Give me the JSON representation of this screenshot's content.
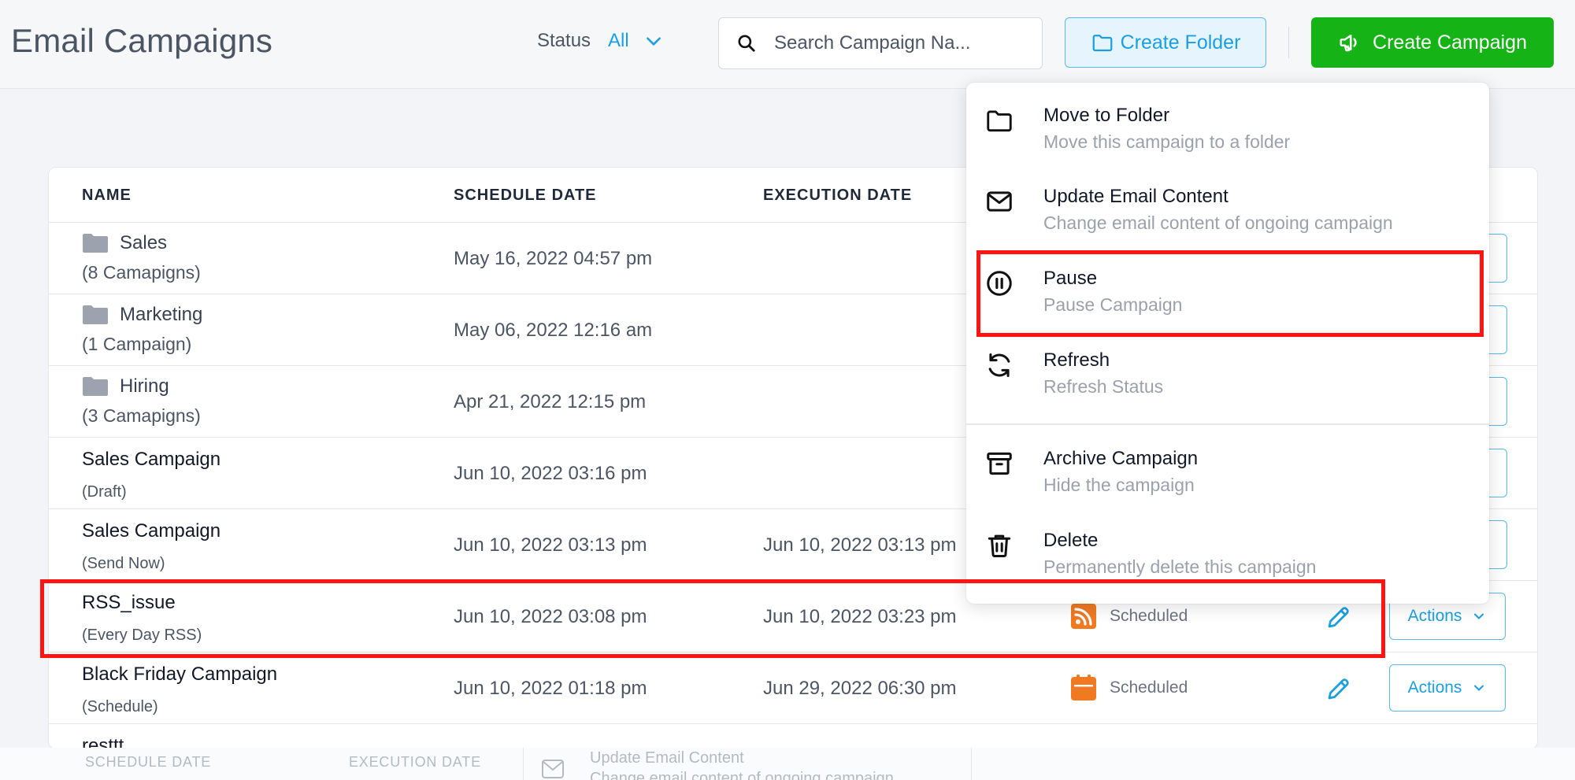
{
  "header": {
    "title": "Email Campaigns",
    "status_label": "Status",
    "status_value": "All",
    "search_placeholder": "Search Campaign Na...",
    "create_folder_label": "Create Folder",
    "create_campaign_label": "Create Campaign"
  },
  "table": {
    "columns": [
      "NAME",
      "SCHEDULE DATE",
      "EXECUTION DATE"
    ],
    "folders": [
      {
        "name": "Sales",
        "count": "(8 Camapigns)",
        "schedule_date": "May 16, 2022 04:57 pm"
      },
      {
        "name": "Marketing",
        "count": "(1 Campaign)",
        "schedule_date": "May 06, 2022 12:16 am"
      },
      {
        "name": "Hiring",
        "count": "(3 Camapigns)",
        "schedule_date": "Apr 21, 2022 12:15 pm"
      }
    ],
    "campaigns": [
      {
        "name": "Sales Campaign",
        "type": "(Draft)",
        "schedule_date": "Jun 10, 2022 03:16 pm",
        "execution_date": "",
        "status": "",
        "actions": ""
      },
      {
        "name": "Sales Campaign",
        "type": "(Send Now)",
        "schedule_date": "Jun 10, 2022 03:13 pm",
        "execution_date": "Jun 10, 2022 03:13 pm",
        "status": "",
        "actions": ""
      },
      {
        "name": "RSS_issue",
        "type": "(Every Day RSS)",
        "schedule_date": "Jun 10, 2022 03:08 pm",
        "execution_date": "Jun 10, 2022 03:23 pm",
        "status": "Scheduled",
        "actions": "Actions"
      },
      {
        "name": "Black Friday Campaign",
        "type": "(Schedule)",
        "schedule_date": "Jun 10, 2022 01:18 pm",
        "execution_date": "Jun 29, 2022 06:30 pm",
        "status": "Scheduled",
        "actions": "Actions"
      },
      {
        "name": "resttt",
        "type": "",
        "schedule_date": "",
        "execution_date": "",
        "status": "",
        "actions": ""
      }
    ]
  },
  "menu": {
    "items": [
      {
        "title": "Move to Folder",
        "desc": "Move this campaign to a folder",
        "icon": "folder-icon"
      },
      {
        "title": "Update Email Content",
        "desc": "Change email content of ongoing campaign",
        "icon": "mail-icon"
      },
      {
        "title": "Pause",
        "desc": "Pause Campaign",
        "icon": "pause-circle-icon"
      },
      {
        "title": "Refresh",
        "desc": "Refresh Status",
        "icon": "refresh-icon"
      },
      {
        "title": "Archive Campaign",
        "desc": "Hide the campaign",
        "icon": "archive-icon"
      },
      {
        "title": "Delete",
        "desc": "Permanently delete this campaign",
        "icon": "trash-icon"
      }
    ]
  },
  "ghost": {
    "schedule_header": "SCHEDULE DATE",
    "execution_header": "EXECUTION DATE",
    "menu_title": "Update Email Content",
    "menu_desc": "Change email content of ongoing campaign"
  },
  "colors": {
    "accent_blue": "#1a9fe0",
    "create_green": "#16b316",
    "highlight_red": "#ff1414",
    "rss_orange": "#f07a22"
  }
}
